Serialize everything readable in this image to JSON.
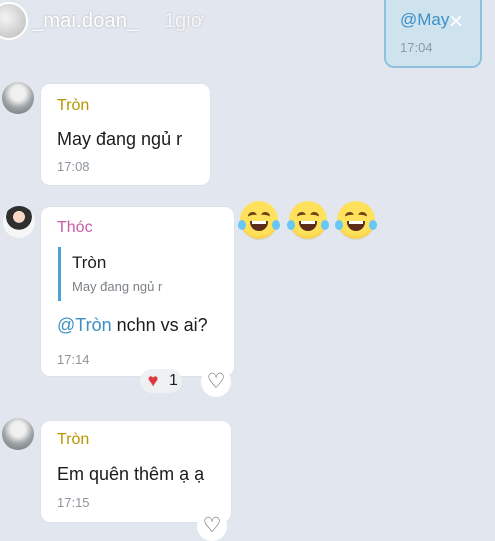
{
  "story_header": {
    "username": "_mai.doan_",
    "time_ago": "1giờ",
    "top_bubble": {
      "mention": "@May",
      "time": "17:04"
    },
    "close_icon": "close-icon"
  },
  "messages": [
    {
      "sender": "Tròn",
      "sender_color": "#b89600",
      "text": "May đang ngủ r",
      "time": "17:08"
    },
    {
      "sender": "Thóc",
      "sender_color": "#c65ca8",
      "quote": {
        "name": "Tròn",
        "text": "May đang ngủ r"
      },
      "mention": "@Tròn",
      "text": "nchn vs ai?",
      "time": "17:14",
      "reaction": {
        "icon": "heart-icon",
        "count": "1"
      }
    },
    {
      "sender": "Tròn",
      "sender_color": "#b89600",
      "text": "Em quên thêm ạ ạ",
      "time": "17:15"
    }
  ],
  "emoji_reactions": [
    "laugh-icon",
    "laugh-icon",
    "laugh-icon"
  ],
  "colors": {
    "background": "#e2e7ef",
    "mention": "#3d8fc4",
    "heart": "#e0363b"
  }
}
